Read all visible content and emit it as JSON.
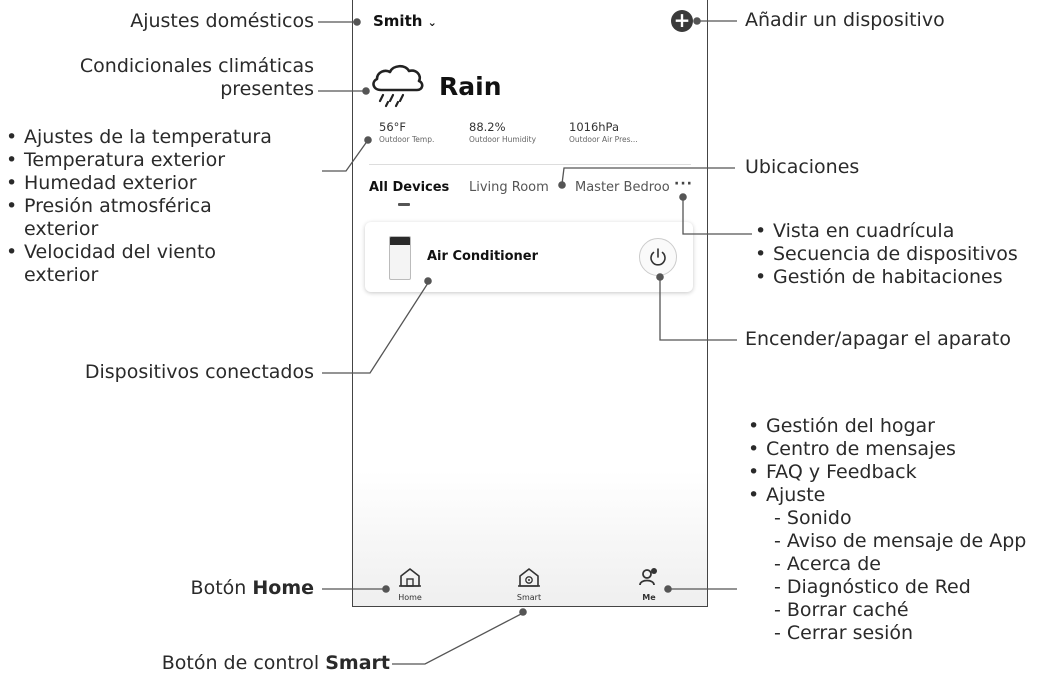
{
  "phone": {
    "home_name": "Smith",
    "weather": "Rain",
    "stats": [
      {
        "value": "56°F",
        "label": "Outdoor Temp."
      },
      {
        "value": "88.2%",
        "label": "Outdoor Humidity"
      },
      {
        "value": "1016hPa",
        "label": "Outdoor Air Pres..."
      }
    ],
    "tabs": [
      "All Devices",
      "Living Room",
      "Master Bedroo"
    ],
    "device": {
      "name": "Air Conditioner"
    },
    "nav": [
      "Home",
      "Smart",
      "Me"
    ]
  },
  "annotations": {
    "ajustes_domesticos": "Ajustes domésticos",
    "condicionales": [
      "Condicionales climáticas",
      "presentes"
    ],
    "temp_list": [
      "Ajustes de la temperatura",
      "Temperatura exterior",
      "Humedad exterior",
      "Presión atmosférica",
      "exterior",
      "Velocidad del viento",
      "exterior"
    ],
    "dispositivos_conectados": "Dispositivos conectados",
    "boton_home": [
      "Botón ",
      "Home"
    ],
    "boton_smart": [
      "Botón de control ",
      "Smart"
    ],
    "anadir": "Añadir un dispositivo",
    "ubicaciones": "Ubicaciones",
    "vista_list": [
      "Vista en cuadrícula",
      "Secuencia de dispositivos",
      "Gestión de habitaciones"
    ],
    "encender": "Encender/apagar el aparato",
    "me_list": [
      "Gestión del hogar",
      "Centro de mensajes",
      "FAQ y Feedback",
      "Ajuste"
    ],
    "me_sub": [
      "- Sonido",
      "- Aviso de mensaje de App",
      "- Acerca de",
      "- Diagnóstico de Red",
      "- Borrar caché",
      "- Cerrar sesión"
    ]
  }
}
